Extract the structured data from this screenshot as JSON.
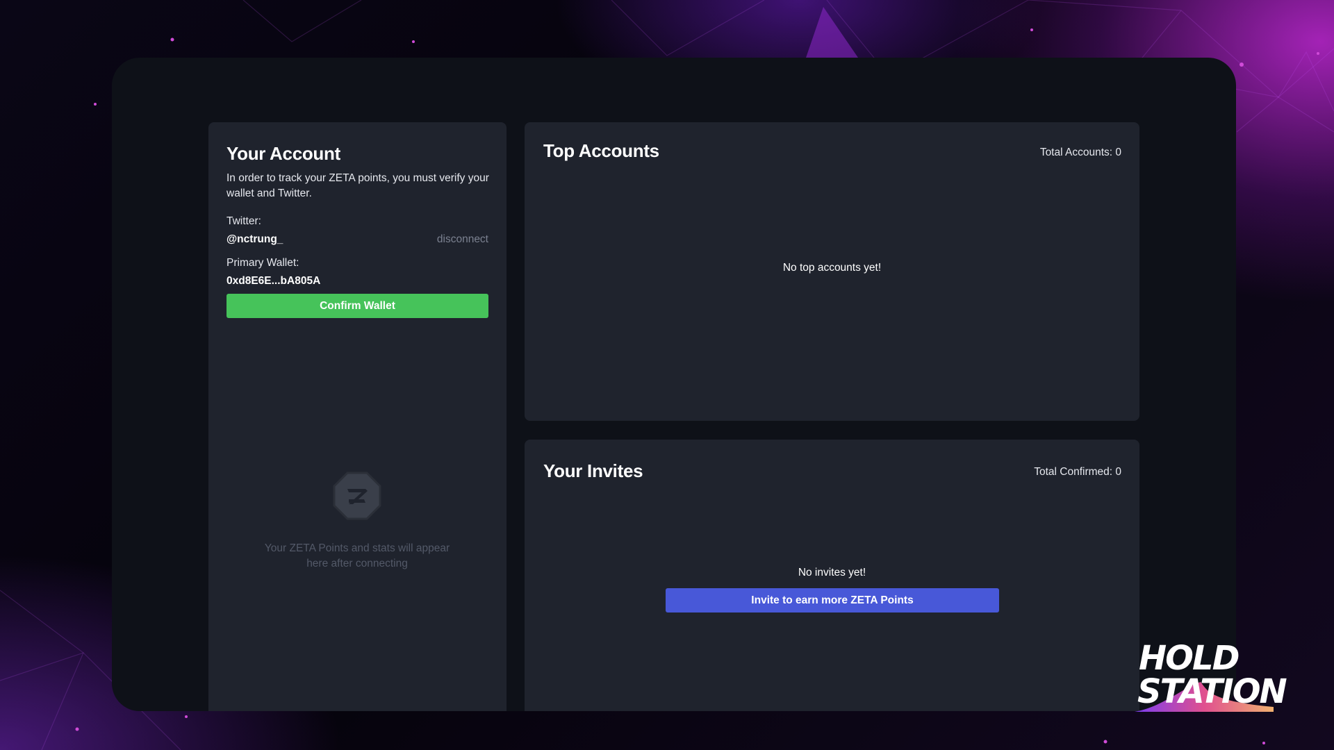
{
  "account": {
    "title": "Your Account",
    "description": "In order to track your ZETA points, you must verify your wallet and Twitter.",
    "twitter_label": "Twitter:",
    "twitter_handle": "@nctrung_",
    "disconnect_label": "disconnect",
    "wallet_label": "Primary Wallet:",
    "wallet_address": "0xd8E6E...bA805A",
    "confirm_button": "Confirm Wallet",
    "placeholder_text": "Your ZETA Points and stats will appear here after connecting"
  },
  "top_accounts": {
    "title": "Top Accounts",
    "total_label": "Total Accounts: 0",
    "empty_message": "No top accounts yet!"
  },
  "invites": {
    "title": "Your Invites",
    "total_label": "Total Confirmed: 0",
    "empty_message": "No invites yet!",
    "invite_button": "Invite to earn more ZETA Points"
  },
  "logo": {
    "line1": "HOLD",
    "line2": "STATION"
  },
  "colors": {
    "confirm_button": "#46c35a",
    "invite_button": "#4858d8",
    "panel": "#1f232d",
    "frame": "#0e1118"
  },
  "icons": {
    "zeta": "zeta-logo-icon"
  }
}
